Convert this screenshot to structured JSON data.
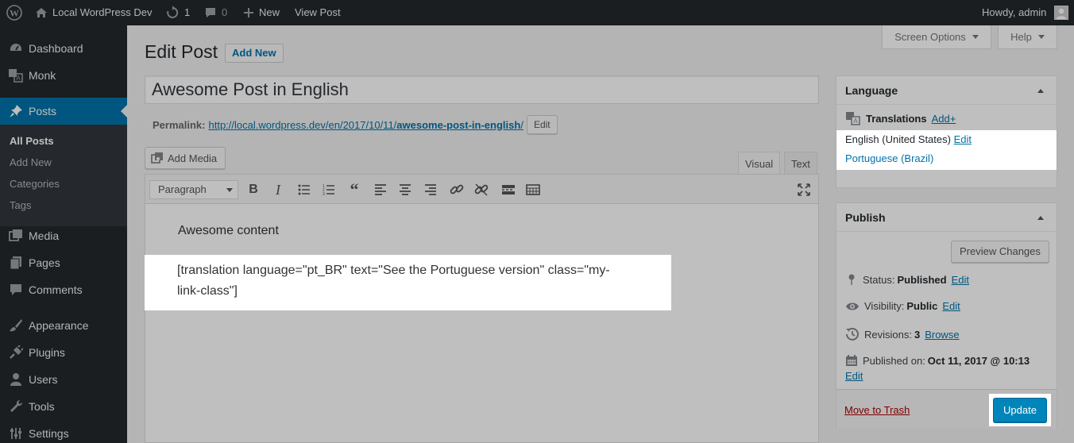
{
  "adminbar": {
    "site_name": "Local WordPress Dev",
    "updates_count": "1",
    "comments_count": "0",
    "new_label": "New",
    "view_post_label": "View Post",
    "howdy": "Howdy, admin"
  },
  "sidebar": {
    "items": [
      {
        "label": "Dashboard",
        "icon": "dashboard-icon"
      },
      {
        "label": "Monk",
        "icon": "translate-icon"
      },
      {
        "label": "Posts",
        "icon": "pin-icon"
      },
      {
        "label": "Media",
        "icon": "media-icon"
      },
      {
        "label": "Pages",
        "icon": "pages-icon"
      },
      {
        "label": "Comments",
        "icon": "comment-icon"
      },
      {
        "label": "Appearance",
        "icon": "brush-icon"
      },
      {
        "label": "Plugins",
        "icon": "plug-icon"
      },
      {
        "label": "Users",
        "icon": "user-icon"
      },
      {
        "label": "Tools",
        "icon": "wrench-icon"
      },
      {
        "label": "Settings",
        "icon": "settings-icon"
      }
    ],
    "submenu": [
      "All Posts",
      "Add New",
      "Categories",
      "Tags"
    ]
  },
  "header": {
    "screen_options": "Screen Options",
    "help": "Help",
    "title": "Edit Post",
    "add_new": "Add New"
  },
  "post": {
    "title": "Awesome Post in English",
    "permalink_label": "Permalink:",
    "permalink_base": "http://local.wordpress.dev/en/2017/10/11/",
    "permalink_slug": "awesome-post-in-english",
    "permalink_trail": "/",
    "edit_label": "Edit"
  },
  "editor": {
    "add_media": "Add Media",
    "tab_visual": "Visual",
    "tab_text": "Text",
    "format_value": "Paragraph",
    "content": [
      "Awesome content",
      "[translation language=\"pt_BR\" text=\"See the Portuguese version\" class=\"my-",
      "link-class\"]"
    ]
  },
  "language_box": {
    "title": "Language",
    "translations_label": "Translations",
    "add_link": "Add+",
    "entries": [
      {
        "name": "English (United States)",
        "action": "Edit"
      },
      {
        "name": "Portuguese (Brazil)"
      }
    ]
  },
  "publish_box": {
    "title": "Publish",
    "preview": "Preview Changes",
    "status_label": "Status:",
    "status_value": "Published",
    "visibility_label": "Visibility:",
    "visibility_value": "Public",
    "revisions_label": "Revisions:",
    "revisions_value": "3",
    "browse": "Browse",
    "published_on_label": "Published on:",
    "published_on_value": "Oct 11, 2017 @ 10:13",
    "edit": "Edit",
    "trash": "Move to Trash",
    "update": "Update"
  },
  "colors": {
    "admin_dark": "#23282d",
    "accent": "#0073aa",
    "trash_red": "#a00"
  }
}
